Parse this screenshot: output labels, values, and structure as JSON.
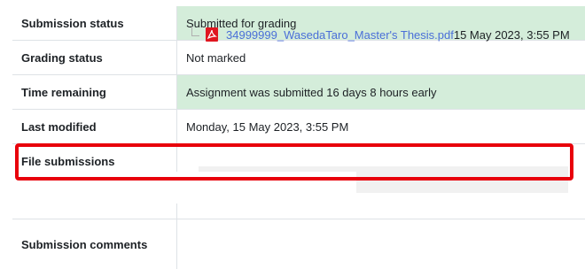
{
  "rows": [
    {
      "label": "Submission status",
      "value": "Submitted for grading"
    },
    {
      "label": "Grading status",
      "value": "Not marked"
    },
    {
      "label": "Time remaining",
      "value": "Assignment was submitted 16 days 8 hours early"
    },
    {
      "label": "Last modified",
      "value": "Monday, 15 May 2023, 3:55 PM"
    },
    {
      "label": "File submissions",
      "value": ""
    },
    {
      "label": "Submission comments",
      "value": ""
    }
  ],
  "file": {
    "name": "34999999_WasedaTaro_Master's Thesis.pdf",
    "date": "15 May 2023, 3:55 PM",
    "icon": "pdf-file-icon"
  },
  "colors": {
    "success_bg": "#d4edda",
    "highlight_border": "#e8000b",
    "link": "#4a6fd8"
  }
}
